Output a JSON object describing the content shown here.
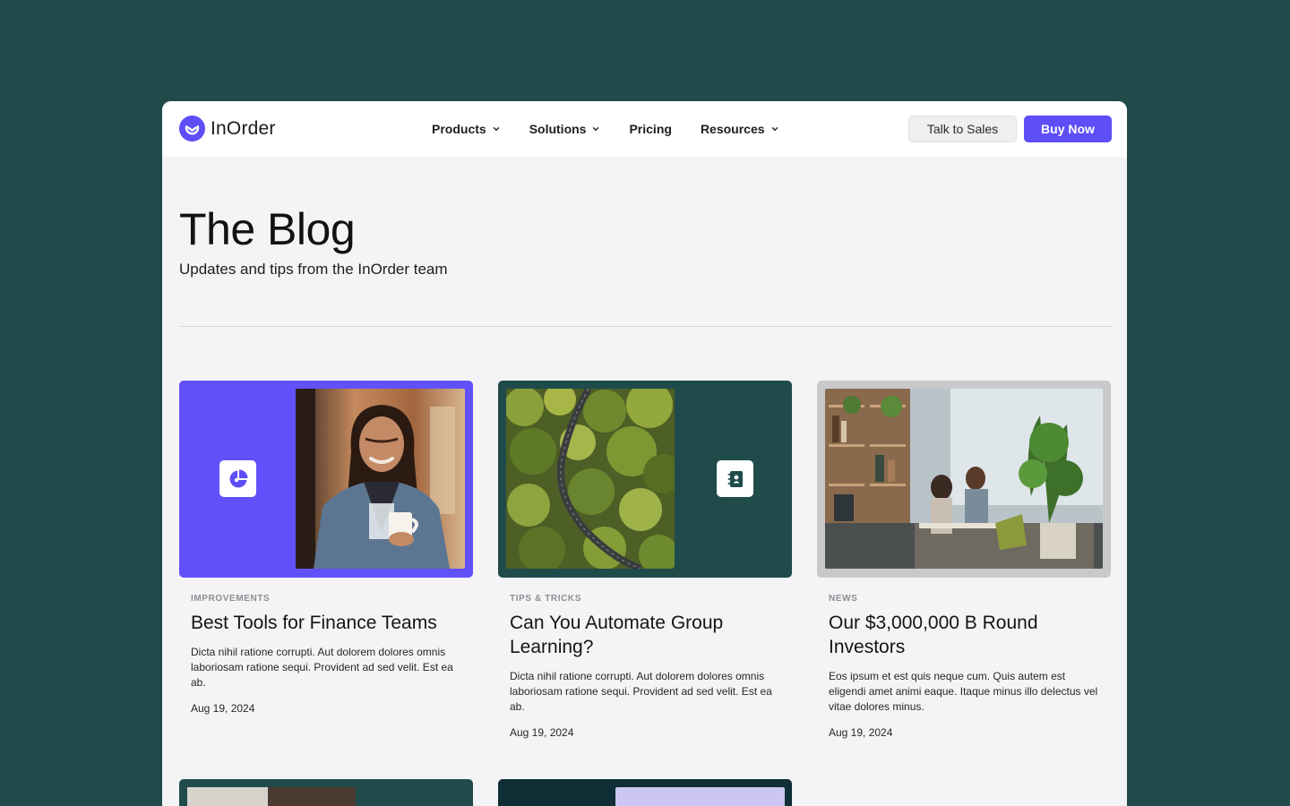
{
  "brand": {
    "name": "InOrder",
    "accent": "#5d4ef8",
    "dark": "#214b4b"
  },
  "nav": {
    "items": [
      {
        "label": "Products",
        "has_dropdown": true
      },
      {
        "label": "Solutions",
        "has_dropdown": true
      },
      {
        "label": "Pricing",
        "has_dropdown": false
      },
      {
        "label": "Resources",
        "has_dropdown": true
      }
    ],
    "talk_to_sales": "Talk to Sales",
    "buy_now": "Buy Now"
  },
  "hero": {
    "title": "The Blog",
    "subtitle": "Updates and tips from the InOrder team"
  },
  "posts": [
    {
      "category": "IMPROVEMENTS",
      "title": "Best Tools for Finance Teams",
      "excerpt": "Dicta nihil ratione corrupti. Aut dolorem dolores omnis laboriosam ratione sequi. Provident ad sed velit. Est ea ab.",
      "date": "Aug 19, 2024",
      "icon": "pie-chart-icon",
      "bg": "#6151fa"
    },
    {
      "category": "TIPS & TRICKS",
      "title": "Can You Automate Group Learning?",
      "excerpt": "Dicta nihil ratione corrupti. Aut dolorem dolores omnis laboriosam ratione sequi. Provident ad sed velit. Est ea ab.",
      "date": "Aug 19, 2024",
      "icon": "contact-book-icon",
      "bg": "#1f4b4b"
    },
    {
      "category": "NEWS",
      "title": "Our $3,000,000 B Round Investors",
      "excerpt": "Eos ipsum et est quis neque cum. Quis autem est eligendi amet animi eaque. Itaque minus illo delectus vel vitae dolores minus.",
      "date": "Aug 19, 2024",
      "bg": "#c9c9cb"
    }
  ]
}
